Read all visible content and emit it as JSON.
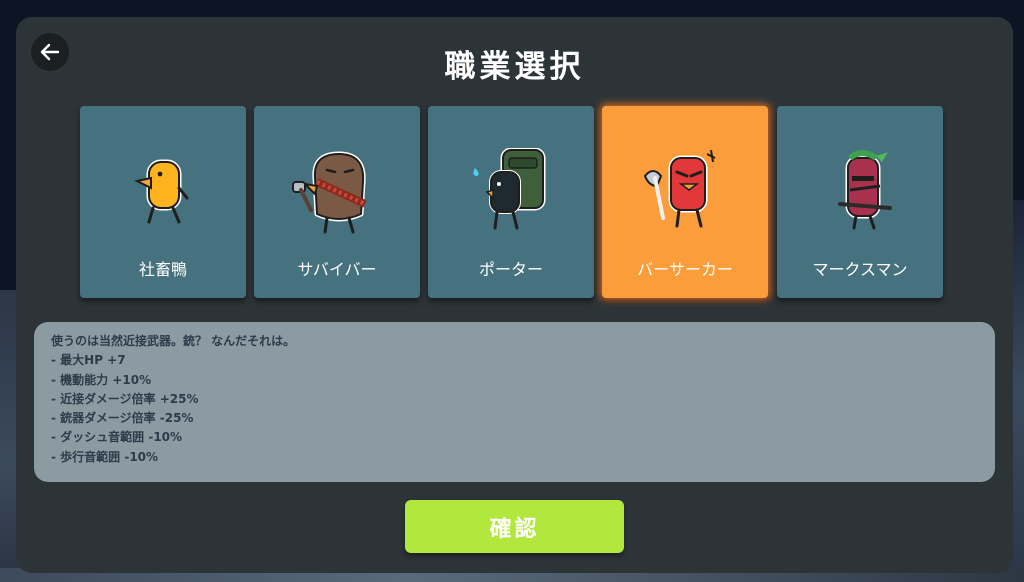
{
  "screen": {
    "title": "職業選択",
    "confirm_label": "確認"
  },
  "classes": [
    {
      "label": "社畜鴨",
      "icon": "yellow-duck-icon",
      "selected": false
    },
    {
      "label": "サバイバー",
      "icon": "brown-survivor-duck-icon",
      "selected": false
    },
    {
      "label": "ポーター",
      "icon": "backpack-porter-duck-icon",
      "selected": false
    },
    {
      "label": "バーサーカー",
      "icon": "red-berserker-duck-icon",
      "selected": true
    },
    {
      "label": "マークスマン",
      "icon": "marksman-duck-icon",
      "selected": false
    }
  ],
  "description": {
    "lines": [
      "使うのは当然近接武器。銃？ なんだそれは。",
      "- 最大HP +7",
      "- 機動能力 +10%",
      "- 近接ダメージ倍率 +25%",
      "- 銃器ダメージ倍率 -25%",
      "- ダッシュ音範囲 -10%",
      "- 歩行音範囲 -10%"
    ]
  },
  "colors": {
    "card": "#46717f",
    "card_selected": "#fb9d3a",
    "confirm": "#b2e83e",
    "panel": "#2d3438",
    "description_bg": "#8c9aa2"
  }
}
